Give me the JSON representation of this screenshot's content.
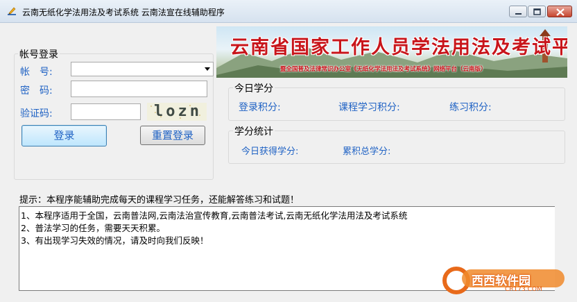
{
  "window": {
    "title": "云南无纸化学法用法及考试系统 云南法宣在线辅助程序"
  },
  "banner": {
    "title": "云南省国家工作人员学法用法及考试平台",
    "subtitle": "暨全国普及法律常识办公室《无纸化学法用法及考试系统》网络平台（云南版）"
  },
  "login": {
    "group_label": "帐号登录",
    "account_label": "帐　号:",
    "account_value": "",
    "password_label": "密　码:",
    "password_value": "",
    "captcha_label": "验证码:",
    "captcha_value": "",
    "captcha_image_text": "lozn",
    "login_button": "登录",
    "reset_button": "重置登录"
  },
  "today": {
    "group_label": "今日学分",
    "login_points": "登录积分:",
    "course_points": "课程学习积分:",
    "practice_points": "练习积分:"
  },
  "stats": {
    "group_label": "学分统计",
    "today_earned": "今日获得学分:",
    "total_points": "累积总学分:"
  },
  "tip": "提示：本程序能辅助完成每天的课程学习任务，还能解答练习和试题！",
  "notes": [
    "1、本程序适用于全国，云南普法网,云南法治宣传教育,云南普法考试,云南无纸化学法用法及考试系统",
    "2、普法学习的任务，需要天天积累。",
    "3、有出现学习失效的情况，请及时向我们反映！"
  ],
  "watermark": {
    "text": "西西软件园",
    "url": "CR173.COM"
  }
}
